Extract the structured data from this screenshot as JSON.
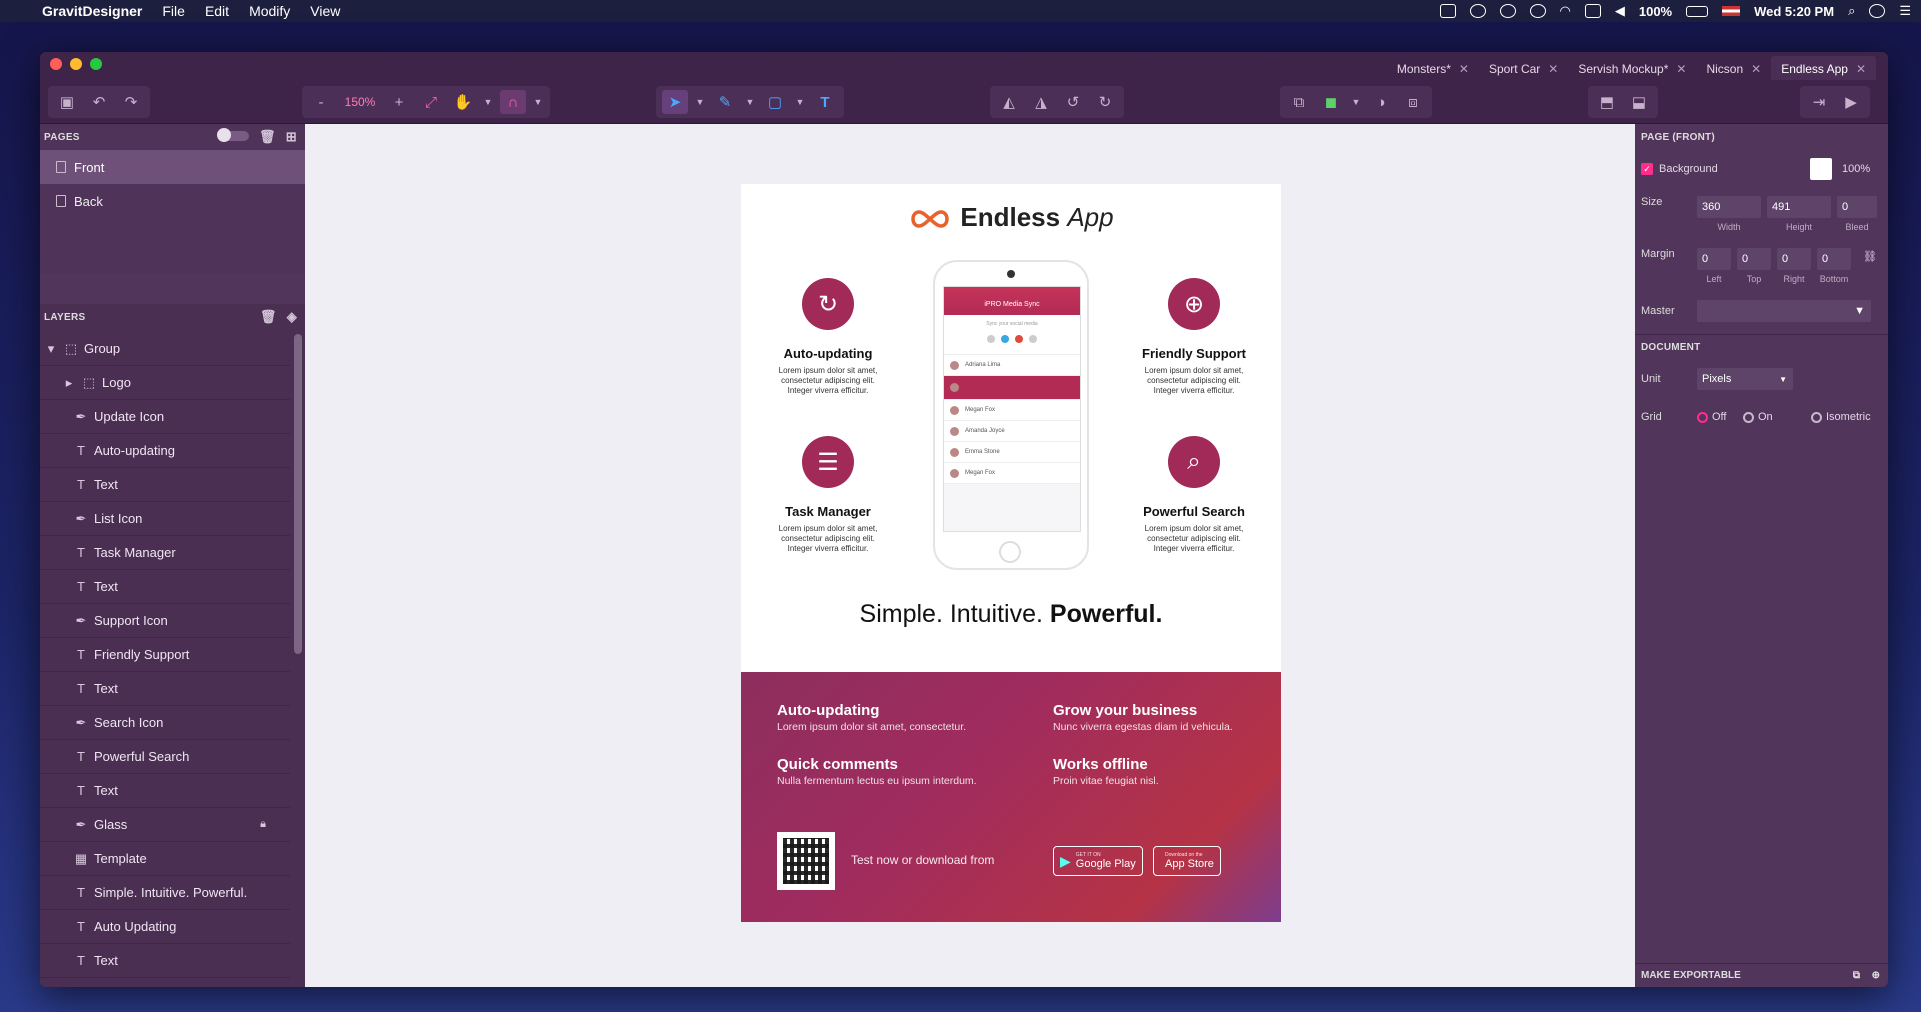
{
  "menubar": {
    "app_name": "GravitDesigner",
    "menus": [
      "File",
      "Edit",
      "Modify",
      "View"
    ],
    "battery": "100%",
    "clock": "Wed 5:20 PM"
  },
  "tabs": [
    "Monsters*",
    "Sport Car",
    "Servish Mockup*",
    "Nicson",
    "Endless App"
  ],
  "toolbar": {
    "zoom": "150%",
    "zoom_minus": "-",
    "zoom_plus": "+"
  },
  "pages": {
    "header": "PAGES",
    "items": [
      "Front",
      "Back"
    ]
  },
  "layers": {
    "header": "LAYERS",
    "items": [
      {
        "name": "Group",
        "type": "group"
      },
      {
        "name": "Logo",
        "type": "group"
      },
      {
        "name": "Update Icon",
        "type": "path"
      },
      {
        "name": "Auto-updating",
        "type": "text"
      },
      {
        "name": "Text",
        "type": "text"
      },
      {
        "name": "List Icon",
        "type": "path"
      },
      {
        "name": "Task Manager",
        "type": "text"
      },
      {
        "name": "Text",
        "type": "text"
      },
      {
        "name": "Support Icon",
        "type": "path"
      },
      {
        "name": "Friendly Support",
        "type": "text"
      },
      {
        "name": "Text",
        "type": "text"
      },
      {
        "name": "Search Icon",
        "type": "path"
      },
      {
        "name": "Powerful Search",
        "type": "text"
      },
      {
        "name": "Text",
        "type": "text"
      },
      {
        "name": "Glass",
        "type": "path"
      },
      {
        "name": "Template",
        "type": "image"
      },
      {
        "name": "Simple. Intuitive. Powerful.",
        "type": "text"
      },
      {
        "name": "Auto Updating",
        "type": "text"
      },
      {
        "name": "Text",
        "type": "text"
      }
    ]
  },
  "inspector": {
    "page_header": "PAGE (FRONT)",
    "background_label": "Background",
    "background_opacity": "100%",
    "size_label": "Size",
    "width": "360",
    "height": "491",
    "bleed": "0",
    "width_lab": "Width",
    "height_lab": "Height",
    "bleed_lab": "Bleed",
    "margin_label": "Margin",
    "margin_left": "0",
    "margin_top": "0",
    "margin_right": "0",
    "margin_bottom": "0",
    "left_lab": "Left",
    "top_lab": "Top",
    "right_lab": "Right",
    "bottom_lab": "Bottom",
    "master_label": "Master",
    "document_header": "DOCUMENT",
    "unit_label": "Unit",
    "unit_value": "Pixels",
    "grid_label": "Grid",
    "grid_off": "Off",
    "grid_on": "On",
    "grid_iso": "Isometric",
    "export_label": "MAKE EXPORTABLE"
  },
  "artboard": {
    "title_bold": "Endless",
    "title_light": "App",
    "features": [
      {
        "title": "Auto-updating",
        "desc": "Lorem ipsum dolor sit amet, consectetur adipiscing elit. Integer viverra efficitur."
      },
      {
        "title": "Friendly Support",
        "desc": "Lorem ipsum dolor sit amet, consectetur adipiscing elit. Integer viverra efficitur."
      },
      {
        "title": "Task Manager",
        "desc": "Lorem ipsum dolor sit amet, consectetur adipiscing elit. Integer viverra efficitur."
      },
      {
        "title": "Powerful Search",
        "desc": "Lorem ipsum dolor sit amet, consectetur adipiscing elit. Integer viverra efficitur."
      }
    ],
    "phone": {
      "header": "iPRO Media Sync",
      "subheader": "Sync your social media",
      "contacts": [
        "Adriana Lima",
        "",
        "Megan Fox",
        "Amanda Joyce",
        "Emma Stone",
        "Megan Fox"
      ]
    },
    "slogan_a": "Simple. Intuitive.",
    "slogan_b": "Powerful.",
    "benefits": [
      {
        "title": "Auto-updating",
        "desc": "Lorem ipsum dolor sit amet, consectetur."
      },
      {
        "title": "Grow your business",
        "desc": "Nunc viverra egestas diam id vehicula."
      },
      {
        "title": "Quick comments",
        "desc": "Nulla fermentum lectus eu ipsum interdum."
      },
      {
        "title": "Works offline",
        "desc": "Proin vitae feugiat nisl."
      }
    ],
    "download_text": "Test now or download from",
    "google_small": "GET IT ON",
    "google_big": "Google Play",
    "apple_small": "Download on the",
    "apple_big": "App Store"
  }
}
